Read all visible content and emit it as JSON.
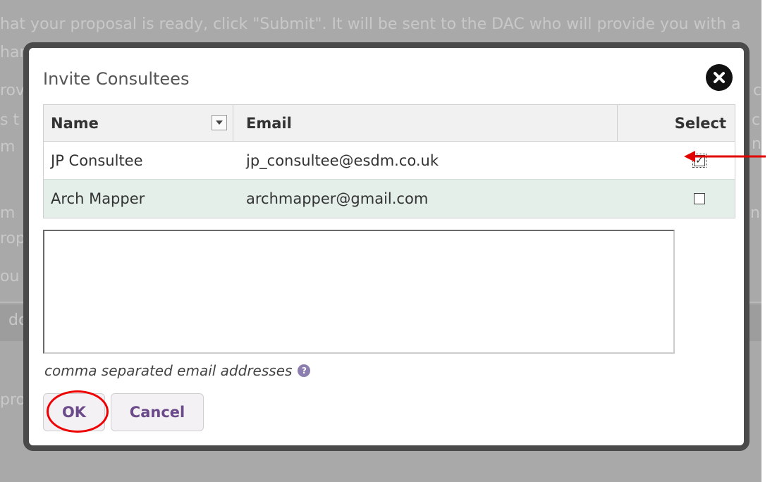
{
  "background": {
    "lines": [
      "hat your proposal is ready, click \"Submit\". It will be sent to the DAC who will provide you with a",
      "han",
      "rov",
      "s t",
      "m",
      "m",
      "rop",
      "ou",
      "do",
      "pro"
    ],
    "right_fragments": [
      "c",
      "ch",
      "n",
      "nit"
    ]
  },
  "modal": {
    "title": "Invite Consultees",
    "close_icon": "close-circle-icon",
    "table": {
      "columns": [
        "Name",
        "Email",
        "Select"
      ],
      "rows": [
        {
          "name": "JP Consultee",
          "email": "jp_consultee@esdm.co.uk",
          "selected": true
        },
        {
          "name": "Arch Mapper",
          "email": "archmapper@gmail.com",
          "selected": false
        }
      ]
    },
    "emails_value": "",
    "hint": "comma separated email addresses",
    "help_icon": "question-circle-icon",
    "ok_label": "OK",
    "cancel_label": "Cancel"
  },
  "colors": {
    "annotation": "#e00000",
    "button_text": "#6b4a8a",
    "alt_row": "#e3efe8"
  }
}
